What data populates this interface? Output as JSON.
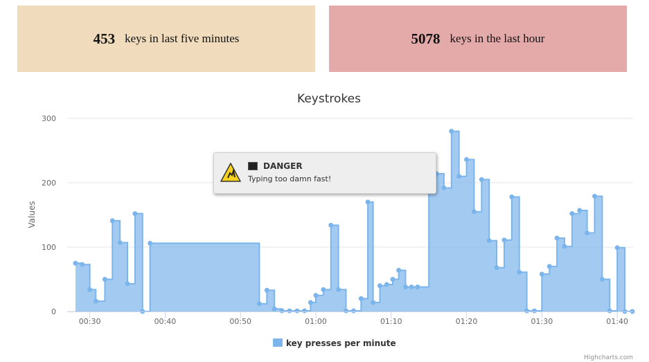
{
  "stats": {
    "five_min": {
      "value": "453",
      "label": "keys in last five minutes",
      "color": "#f0dcbc"
    },
    "hour": {
      "value": "5078",
      "label": "keys in the last hour",
      "color": "#e4aaaa"
    }
  },
  "chart_data": {
    "type": "area",
    "step": true,
    "title": "Keystrokes",
    "ylabel": "Values",
    "ylim": [
      0,
      300
    ],
    "yticks": [
      0,
      100,
      200,
      300
    ],
    "xtick_labels": [
      "00:30",
      "00:40",
      "00:50",
      "01:00",
      "01:10",
      "01:20",
      "01:30",
      "01:40"
    ],
    "xtick_minutes": [
      30,
      40,
      50,
      60,
      70,
      80,
      90,
      100
    ],
    "grid": true,
    "legend_position": "bottom",
    "credits": "Highcharts.com",
    "series": [
      {
        "name": "key presses per minute",
        "color": "#7cb5ec",
        "x": [
          28.1,
          29,
          30,
          30.8,
          32,
          33,
          34,
          35,
          36,
          37,
          38,
          52.5,
          53.5,
          54.5,
          55.5,
          56.5,
          57.5,
          58.5,
          59.3,
          60,
          61,
          62,
          63,
          64,
          65,
          66,
          66.9,
          67.6,
          68.5,
          69.4,
          70.2,
          71,
          71.9,
          72.7,
          73.5,
          75,
          76,
          77,
          78,
          79,
          80,
          81,
          82,
          83,
          84,
          85,
          86,
          87,
          88,
          89,
          90,
          91,
          92,
          93,
          94,
          95,
          96,
          97,
          98,
          99,
          100,
          101,
          102
        ],
        "values": [
          75,
          73,
          34,
          16,
          50,
          141,
          107,
          43,
          152,
          0,
          106,
          12,
          33,
          4,
          1,
          1,
          1,
          1,
          14,
          25,
          34,
          134,
          34,
          1,
          1,
          20,
          170,
          14,
          40,
          42,
          50,
          64,
          38,
          38,
          38,
          210,
          214,
          192,
          280,
          210,
          236,
          155,
          205,
          110,
          68,
          111,
          178,
          61,
          1,
          1,
          58,
          70,
          114,
          101,
          152,
          157,
          122,
          179,
          50,
          1,
          99,
          0,
          0
        ]
      }
    ]
  },
  "tooltip": {
    "icon": "warning-icon",
    "sub_icon": "terminal-icon",
    "title": "DANGER",
    "message": "Typing too damn fast!"
  }
}
